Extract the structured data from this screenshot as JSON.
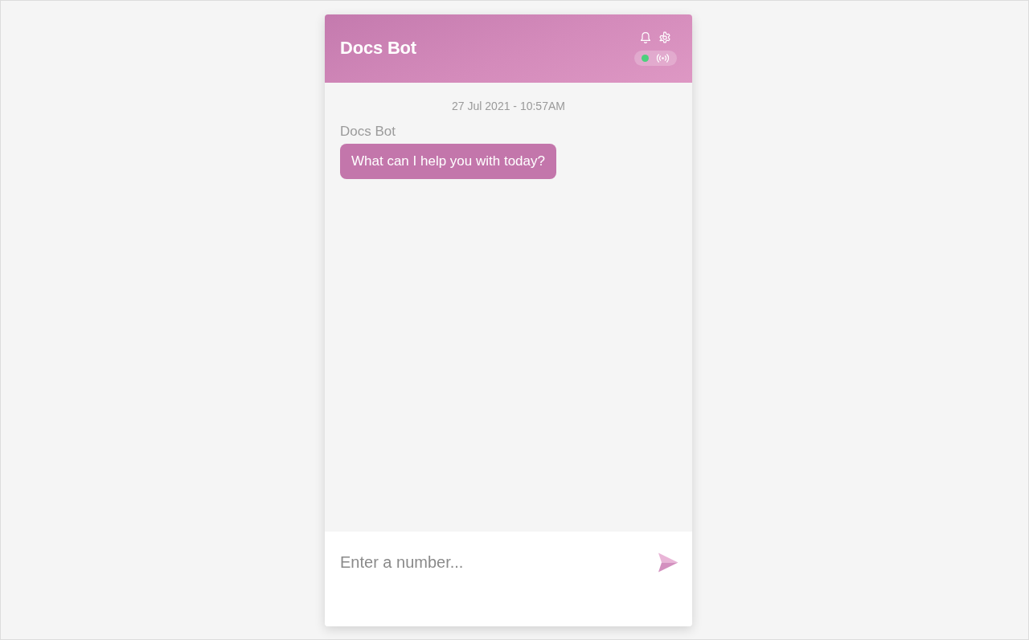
{
  "header": {
    "title": "Docs Bot",
    "status": {
      "online": true
    }
  },
  "messages": [
    {
      "timestamp": "27 Jul 2021 - 10:57AM",
      "sender": "Docs Bot",
      "text": "What can I help you with today?"
    }
  ],
  "composer": {
    "placeholder": "Enter a number..."
  }
}
